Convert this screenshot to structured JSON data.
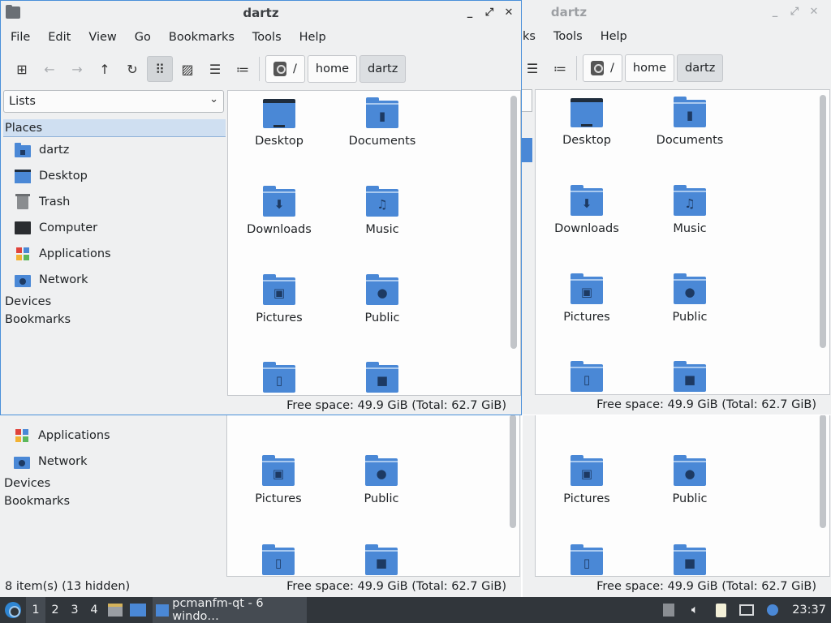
{
  "window": {
    "title": "dartz",
    "menu": [
      "File",
      "Edit",
      "View",
      "Go",
      "Bookmarks",
      "Tools",
      "Help"
    ],
    "breadcrumb": [
      "/",
      "home",
      "dartz"
    ],
    "side_combo": "Lists",
    "side": {
      "places": "Places",
      "items": [
        "dartz",
        "Desktop",
        "Trash",
        "Computer",
        "Applications",
        "Network"
      ],
      "devices": "Devices",
      "bookmarks": "Bookmarks"
    },
    "files": [
      "Desktop",
      "Documents",
      "Downloads",
      "Music",
      "Pictures",
      "Public"
    ],
    "free_space": "Free space: 49.9 GiB (Total: 62.7 GiB)",
    "item_count": "8 item(s) (13 hidden)"
  },
  "inactive": {
    "title": "dartz",
    "menu": [
      "ks",
      "Tools",
      "Help"
    ],
    "breadcrumb": [
      "/",
      "home",
      "dartz"
    ]
  },
  "bottom": {
    "side_items": [
      "Applications",
      "Network"
    ],
    "devices": "Devices",
    "bookmarks": "Bookmarks",
    "files": [
      "Pictures",
      "Public"
    ]
  },
  "icons": {
    "new_tab": "new-tab-icon",
    "back": "back-arrow-icon",
    "forward": "forward-arrow-icon",
    "up": "up-arrow-icon",
    "reload": "reload-icon",
    "icon_view": "icon-view-icon",
    "thumb_view": "thumbnail-view-icon",
    "compact_view": "compact-view-icon",
    "detail_view": "detailed-list-icon"
  },
  "taskbar": {
    "desktops": [
      "1",
      "2",
      "3",
      "4"
    ],
    "task_label": "pcmanfm-qt - 6 windo…",
    "clock": "23:37"
  },
  "colors": {
    "accent": "#4a88d6",
    "taskbar": "#31363b",
    "selection": "#cfdff1"
  }
}
